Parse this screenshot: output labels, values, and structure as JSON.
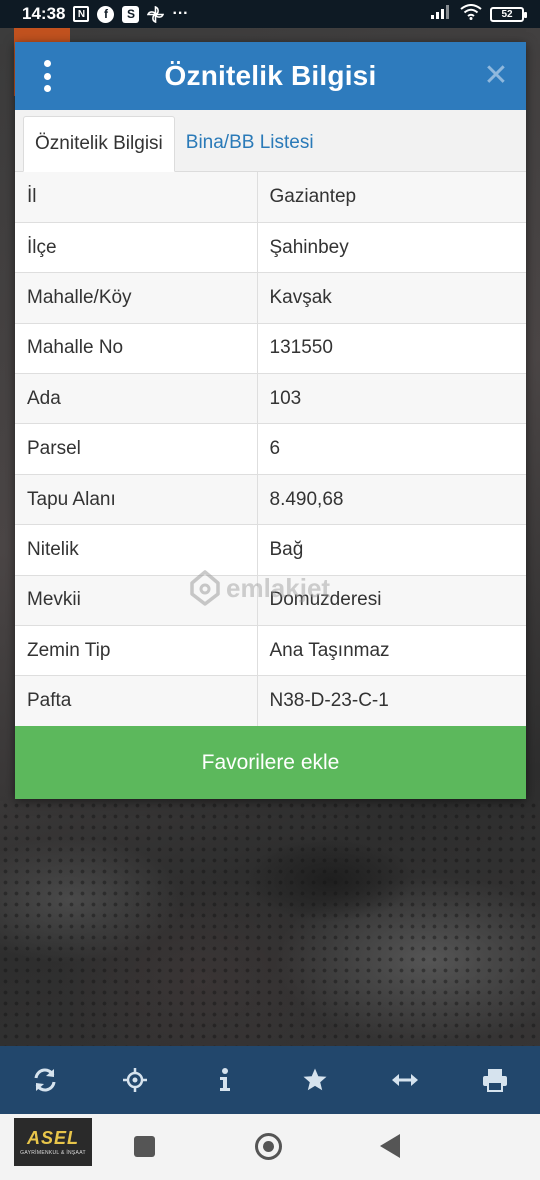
{
  "status_bar": {
    "time": "14:38",
    "icons": [
      "nfc-icon",
      "facebook-icon",
      "s-app-icon",
      "pinwheel-icon",
      "more-dots-icon"
    ],
    "more": "···",
    "battery": "52"
  },
  "dialog": {
    "title": "Öznitelik Bilgisi",
    "close": "✕",
    "tabs": [
      {
        "label": "Öznitelik Bilgisi",
        "active": true
      },
      {
        "label": "Bina/BB Listesi",
        "active": false
      }
    ],
    "rows": [
      {
        "key": "İl",
        "value": "Gaziantep"
      },
      {
        "key": "İlçe",
        "value": "Şahinbey"
      },
      {
        "key": "Mahalle/Köy",
        "value": "Kavşak"
      },
      {
        "key": "Mahalle No",
        "value": "131550"
      },
      {
        "key": "Ada",
        "value": "103"
      },
      {
        "key": "Parsel",
        "value": "6"
      },
      {
        "key": "Tapu Alanı",
        "value": "8.490,68"
      },
      {
        "key": "Nitelik",
        "value": "Bağ"
      },
      {
        "key": "Mevkii",
        "value": "Domuzderesi"
      },
      {
        "key": "Zemin Tip",
        "value": "Ana Taşınmaz"
      },
      {
        "key": "Pafta",
        "value": "N38-D-23-C-1"
      }
    ],
    "favorite_button": "Favorilere ekle"
  },
  "watermark": "emlakjet",
  "toolbar": {
    "tools": [
      "refresh-icon",
      "locate-icon",
      "info-icon",
      "star-icon",
      "measure-icon",
      "print-icon"
    ]
  },
  "logo": {
    "main": "ASEL",
    "sub": "GAYRİMENKUL & İNŞAAT"
  },
  "colors": {
    "header": "#2e7bbd",
    "favorite_button": "#5cb85c",
    "toolbar": "#22476c",
    "tab_link": "#2a7ab8"
  }
}
